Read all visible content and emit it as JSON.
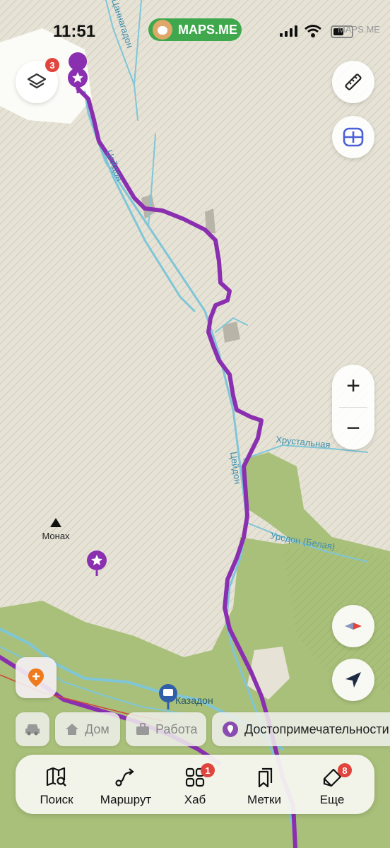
{
  "status_bar": {
    "time": "11:51",
    "brand": "MAPS.ME",
    "battery_label": "MAPS.ME"
  },
  "map": {
    "labels": {
      "river_top": "Цаннагадон",
      "river_tseydon_1": "Цейдон",
      "river_tseydon_2": "Цейдон",
      "river_khrustalnaya": "Хрустальная",
      "river_ursdon": "Урсдон (Белая)",
      "river_kazdon": "Казадон",
      "peak": "Монах"
    },
    "colors": {
      "route": "#8a2fb0",
      "river": "#7fc6d8",
      "forest": "#a9c07a",
      "background": "#e6e3d6"
    }
  },
  "controls": {
    "layers": {
      "icon": "layers-icon",
      "badge": "3"
    },
    "ruler": {
      "icon": "ruler-icon"
    },
    "guides": {
      "icon": "guides-icon"
    },
    "zoom_in": "+",
    "zoom_out": "−",
    "compass": {
      "icon": "compass-icon"
    },
    "my_location": {
      "icon": "location-arrow-icon"
    },
    "add_place": {
      "icon": "add-place-icon"
    }
  },
  "quick_chips": [
    {
      "icon": "car-icon",
      "label": ""
    },
    {
      "icon": "home-icon",
      "label": "Дом"
    },
    {
      "icon": "briefcase-icon",
      "label": "Работа"
    },
    {
      "icon": "pin-icon",
      "label": "Достопримечательности"
    }
  ],
  "tabbar": {
    "items": [
      {
        "icon": "map-search-icon",
        "label": "Поиск",
        "badge": ""
      },
      {
        "icon": "route-icon",
        "label": "Маршрут",
        "badge": ""
      },
      {
        "icon": "hub-icon",
        "label": "Хаб",
        "badge": "1"
      },
      {
        "icon": "bookmarks-icon",
        "label": "Метки",
        "badge": ""
      },
      {
        "icon": "more-icon",
        "label": "Еще",
        "badge": "8"
      }
    ]
  }
}
